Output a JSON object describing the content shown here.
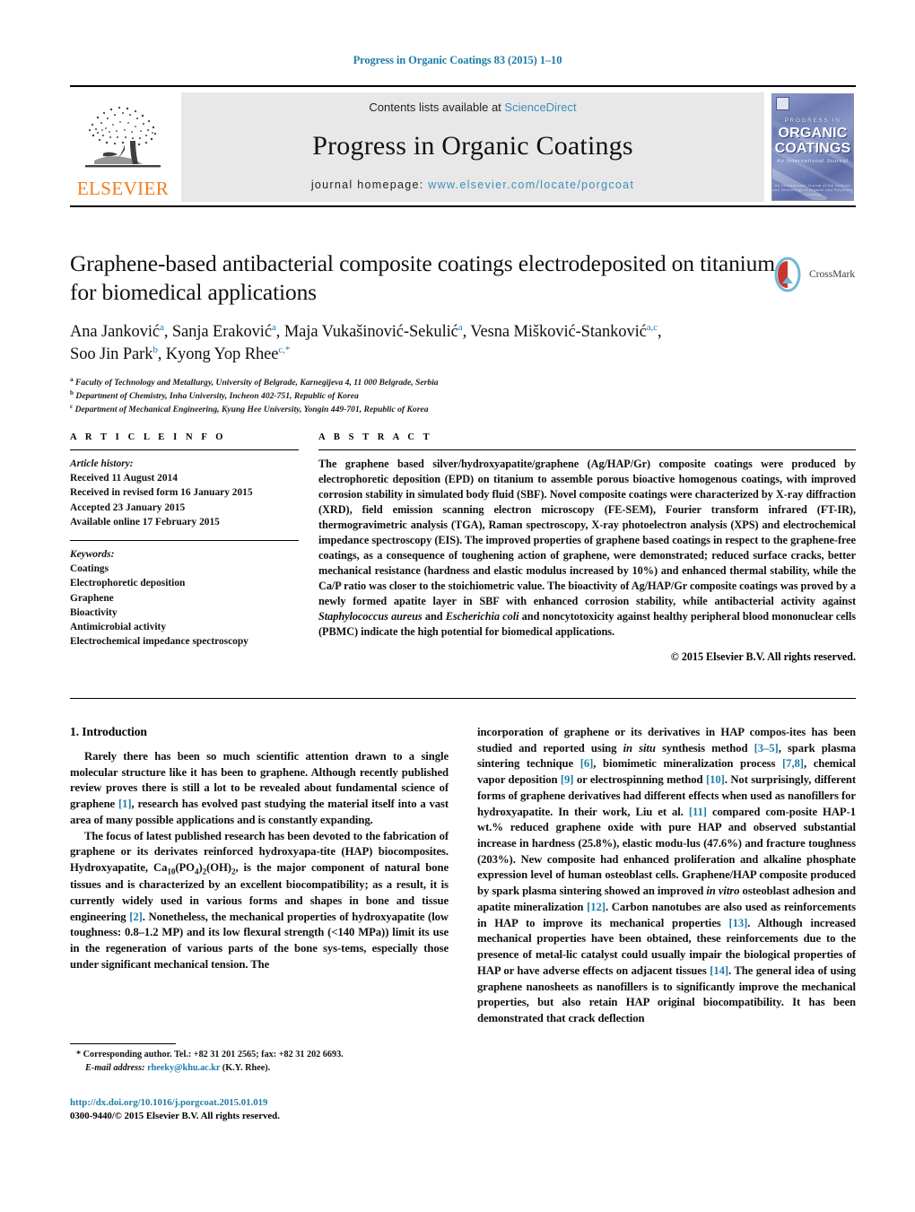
{
  "running_head": "Progress in Organic Coatings 83 (2015) 1–10",
  "masthead": {
    "publisher_logo_text": "ELSEVIER",
    "contents_prefix": "Contents lists available at",
    "contents_link": "ScienceDirect",
    "journal_title": "Progress in Organic Coatings",
    "homepage_prefix": "journal homepage:",
    "homepage_url": "www.elsevier.com/locate/porgcoat",
    "cover": {
      "line1": "PROGRESS IN",
      "line2": "ORGANIC",
      "line3": "COATINGS",
      "line4": "An International Journal",
      "footer": "An International Journal of the Science and Technology of Organic and Polymeric Coatings"
    }
  },
  "article": {
    "title": "Graphene-based antibacterial composite coatings electrodeposited on titanium for biomedical applications",
    "crossmark_label": "CrossMark",
    "authors_line1_a": "Ana Janković",
    "authors_line1_a_sup": "a",
    "authors_line1_b": ", Sanja Eraković",
    "authors_line1_b_sup": "a",
    "authors_line1_c": ", Maja Vukašinović-Sekulić",
    "authors_line1_c_sup": "a",
    "authors_line1_d": ", Vesna Mišković-Stanković",
    "authors_line1_d_sup": "a,c",
    "authors_line1_end": ",",
    "authors_line2_a": "Soo Jin Park",
    "authors_line2_a_sup": "b",
    "authors_line2_b": ", Kyong Yop Rhee",
    "authors_line2_b_sup": "c,*",
    "affiliations": [
      {
        "sup": "a",
        "text": "Faculty of Technology and Metallurgy, University of Belgrade, Karnegijeva 4, 11 000 Belgrade, Serbia"
      },
      {
        "sup": "b",
        "text": "Department of Chemistry, Inha University, Incheon 402-751, Republic of Korea"
      },
      {
        "sup": "c",
        "text": "Department of Mechanical Engineering, Kyung Hee University, Yongin 449-701, Republic of Korea"
      }
    ]
  },
  "article_info": {
    "heading": "A R T I C L E  I N F O",
    "history_label": "Article history:",
    "history": [
      "Received 11 August 2014",
      "Received in revised form 16 January 2015",
      "Accepted 23 January 2015",
      "Available online 17 February 2015"
    ],
    "keywords_label": "Keywords:",
    "keywords": [
      "Coatings",
      "Electrophoretic deposition",
      "Graphene",
      "Bioactivity",
      "Antimicrobial activity",
      "Electrochemical impedance spectroscopy"
    ]
  },
  "abstract": {
    "heading": "A B S T R A C T",
    "part1": "The graphene based silver/hydroxyapatite/graphene (Ag/HAP/Gr) composite coatings were produced by electrophoretic deposition (EPD) on titanium to assemble porous bioactive homogenous coatings, with improved corrosion stability in simulated body fluid (SBF). Novel composite coatings were characterized by X-ray diffraction (XRD), field emission scanning electron microscopy (FE-SEM), Fourier transform infrared (FT-IR), thermogravimetric analysis (TGA), Raman spectroscopy, X-ray photoelectron analysis (XPS) and electrochemical impedance spectroscopy (EIS). The improved properties of graphene based coatings in respect to the graphene-free coatings, as a consequence of toughening action of graphene, were demonstrated; reduced surface cracks, better mechanical resistance (hardness and elastic modulus increased by 10%) and enhanced thermal stability, while the Ca/P ratio was closer to the stoichiometric value. The bioactivity of Ag/HAP/Gr composite coatings was proved by a newly formed apatite layer in SBF with enhanced corrosion stability, while antibacterial activity against ",
    "italic1": "Staphylococcus aureus",
    "part2": " and ",
    "italic2": "Escherichia coli",
    "part3": " and noncytotoxicity against healthy peripheral blood mononuclear cells (PBMC) indicate the high potential for biomedical applications.",
    "copyright": "© 2015 Elsevier B.V. All rights reserved."
  },
  "body": {
    "section_title": "1. Introduction",
    "left": {
      "p1_a": "Rarely there has been so much scientific attention drawn to a single molecular structure like it has been to graphene. Although recently published review proves there is still a lot to be revealed about fundamental science of graphene ",
      "p1_ref1": "[1]",
      "p1_b": ", research has evolved past studying the material itself into a vast area of many possible applications and is constantly expanding.",
      "p2_a": "The focus of latest published research has been devoted to the fabrication of graphene or its derivates reinforced hydroxyapa-tite (HAP) biocomposites. Hydroxyapatite, Ca",
      "p2_sub1": "10",
      "p2_b": "(PO",
      "p2_sub2": "4",
      "p2_c": ")",
      "p2_sub3": "2",
      "p2_d": "(OH)",
      "p2_sub4": "2",
      "p2_e": ", is the major component of natural bone tissues and is characterized by an excellent biocompatibility; as a result, it is currently widely used in various forms and shapes in bone and tissue engineering ",
      "p2_ref2": "[2]",
      "p2_f": ". Nonetheless, the mechanical properties of hydroxyapatite (low toughness: 0.8–1.2 MP) and its low flexural strength (<140 MPa)) limit its use in the regeneration of various parts of the bone sys-tems, especially those under significant mechanical tension. The"
    },
    "right": {
      "p_a": "incorporation of graphene or its derivatives in HAP compos-ites has been studied and reported using ",
      "p_it1": "in situ",
      "p_b": " synthesis method ",
      "p_ref35": "[3–5]",
      "p_c": ", spark plasma sintering technique ",
      "p_ref6": "[6]",
      "p_d": ", biomimetic mineralization process ",
      "p_ref78": "[7,8]",
      "p_e": ", chemical vapor deposition ",
      "p_ref9": "[9]",
      "p_f": " or electrospinning method ",
      "p_ref10": "[10]",
      "p_g": ". Not surprisingly, different forms of graphene derivatives had different effects when used as nanofillers for hydroxyapatite. In their work, Liu et al. ",
      "p_ref11": "[11]",
      "p_h": " compared com-posite HAP-1 wt.% reduced graphene oxide with pure HAP and observed substantial increase in hardness (25.8%), elastic modu-lus (47.6%) and fracture toughness (203%). New composite had enhanced proliferation and alkaline phosphate expression level of human osteoblast cells. Graphene/HAP composite produced by spark plasma sintering showed an improved ",
      "p_it2": "in vitro",
      "p_i": " osteoblast adhesion and apatite mineralization ",
      "p_ref12": "[12]",
      "p_j": ". Carbon nanotubes are also used as reinforcements in HAP to improve its mechanical properties ",
      "p_ref13": "[13]",
      "p_k": ". Although increased mechanical properties have been obtained, these reinforcements due to the presence of metal-lic catalyst could usually impair the biological properties of HAP or have adverse effects on adjacent tissues ",
      "p_ref14": "[14]",
      "p_l": ". The general idea of using graphene nanosheets as nanofillers is to significantly improve the mechanical properties, but also retain HAP original biocompatibility. It has been demonstrated that crack deflection"
    }
  },
  "footnote": {
    "marker": "*",
    "corresponding": "Corresponding author. Tel.: +82 31 201 2565; fax: +82 31 202 6693.",
    "email_label": "E-mail address:",
    "email": "rheeky@khu.ac.kr",
    "email_owner": "(K.Y. Rhee)."
  },
  "doi": {
    "url": "http://dx.doi.org/10.1016/j.porgcoat.2015.01.019",
    "issn_line": "0300-9440/© 2015 Elsevier B.V. All rights reserved."
  },
  "colors": {
    "link": "#1f7ca8",
    "link_light": "#3c8dbc",
    "elsevier_orange": "#f07d1a",
    "band_gray": "#e8e8e8"
  }
}
